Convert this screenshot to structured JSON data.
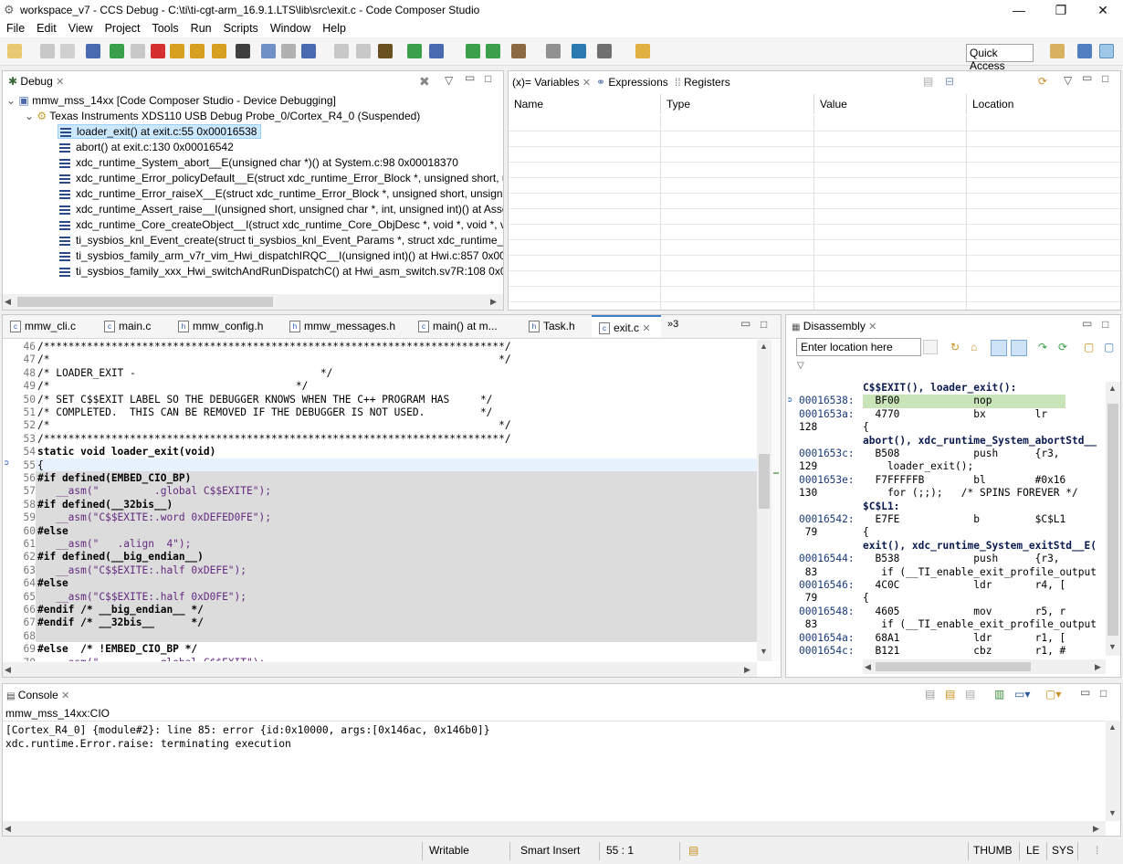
{
  "window": {
    "title": "workspace_v7 - CCS Debug - C:\\ti\\ti-cgt-arm_16.9.1.LTS\\lib\\src\\exit.c - Code Composer Studio",
    "minimize": "—",
    "maximize": "❐",
    "close": "✕"
  },
  "menu": [
    "File",
    "Edit",
    "View",
    "Project",
    "Tools",
    "Run",
    "Scripts",
    "Window",
    "Help"
  ],
  "toolbar": {
    "quick_access": "Quick Access"
  },
  "debug_view": {
    "tab": "Debug",
    "target": "mmw_mss_14xx [Code Composer Studio - Device Debugging]",
    "probe": "Texas Instruments XDS110 USB Debug Probe_0/Cortex_R4_0 (Suspended)",
    "frames": [
      "loader_exit() at exit.c:55 0x00016538",
      "abort() at exit.c:130 0x00016542",
      "xdc_runtime_System_abort__E(unsigned char *)() at System.c:98 0x00018370",
      "xdc_runtime_Error_policyDefault__E(struct xdc_runtime_Error_Block *, unsigned short, unsign",
      "xdc_runtime_Error_raiseX__E(struct xdc_runtime_Error_Block *, unsigned short, unsigned char",
      "xdc_runtime_Assert_raise__I(unsigned short, unsigned char *, int, unsigned int)() at Assert.c:3",
      "xdc_runtime_Core_createObject__I(struct xdc_runtime_Core_ObjDesc *, void *, void *, void *,",
      "ti_sysbios_knl_Event_create(struct ti_sysbios_knl_Event_Params *, struct xdc_runtime_Error_Bl",
      "ti_sysbios_family_arm_v7r_vim_Hwi_dispatchIRQC__I(unsigned int)() at Hwi.c:857 0x0000747C",
      "ti_sysbios_family_xxx_Hwi_switchAndRunDispatchC() at Hwi_asm_switch.sv7R:108 0x000134F"
    ]
  },
  "variables_view": {
    "tabs": [
      "(x)= Variables",
      "Expressions",
      "Registers"
    ],
    "columns": [
      "Name",
      "Type",
      "Value",
      "Location"
    ]
  },
  "editor": {
    "tabs": [
      "mmw_cli.c",
      "main.c",
      "mmw_config.h",
      "mmw_messages.h",
      "main() at m...",
      "Task.h",
      "exit.c"
    ],
    "overflow": "»3",
    "lines": [
      {
        "n": "46",
        "t": "/***************************************************************************/"
      },
      {
        "n": "47",
        "t": "/*                                                                         */"
      },
      {
        "n": "48",
        "t": "/* LOADER_EXIT -                              */"
      },
      {
        "n": "49",
        "t": "/*                                        */"
      },
      {
        "n": "50",
        "t": "/* SET C$$EXIT LABEL SO THE DEBUGGER KNOWS WHEN THE C++ PROGRAM HAS     */"
      },
      {
        "n": "51",
        "t": "/* COMPLETED.  THIS CAN BE REMOVED IF THE DEBUGGER IS NOT USED.         */"
      },
      {
        "n": "52",
        "t": "/*                                                                         */"
      },
      {
        "n": "53",
        "t": "/***************************************************************************/"
      },
      {
        "n": "54",
        "t": "static void loader_exit(void)"
      },
      {
        "n": "55",
        "t": "{"
      },
      {
        "n": "56",
        "t": "#if defined(EMBED_CIO_BP)"
      },
      {
        "n": "57",
        "t": "   __asm(\"         .global C$$EXITE\");"
      },
      {
        "n": "58",
        "t": "#if defined(__32bis__)"
      },
      {
        "n": "59",
        "t": "   __asm(\"C$$EXITE:.word 0xDEFED0FE\");"
      },
      {
        "n": "60",
        "t": "#else"
      },
      {
        "n": "61",
        "t": "   __asm(\"   .align  4\");"
      },
      {
        "n": "62",
        "t": "#if defined(__big_endian__)"
      },
      {
        "n": "63",
        "t": "   __asm(\"C$$EXITE:.half 0xDEFE\");"
      },
      {
        "n": "64",
        "t": "#else"
      },
      {
        "n": "65",
        "t": "   __asm(\"C$$EXITE:.half 0xD0FE\");"
      },
      {
        "n": "66",
        "t": "#endif /* __big_endian__ */"
      },
      {
        "n": "67",
        "t": "#endif /* __32bis__      */"
      },
      {
        "n": "68",
        "t": ""
      },
      {
        "n": "69",
        "t": "#else  /* !EMBED_CIO_BP */"
      },
      {
        "n": "70",
        "t": "   __asm(\"         .global C$$EXIT\");"
      }
    ]
  },
  "disassembly": {
    "tab": "Disassembly",
    "location_placeholder": "Enter location here",
    "lines": [
      {
        "a": "",
        "t": "C$$EXIT(), loader_exit():",
        "h": true
      },
      {
        "a": "00016538:",
        "t": "  BF00            nop",
        "cur": true
      },
      {
        "a": "0001653a:",
        "t": "  4770            bx        lr"
      },
      {
        "a": "128",
        "t": "{"
      },
      {
        "a": "",
        "t": "abort(), xdc_runtime_System_abortStd__",
        "h": true
      },
      {
        "a": "0001653c:",
        "t": "  B508            push      {r3,"
      },
      {
        "a": "129",
        "t": "    loader_exit();"
      },
      {
        "a": "0001653e:",
        "t": "  F7FFFFFB        bl        #0x16"
      },
      {
        "a": "130",
        "t": "    for (;;);   /* SPINS FOREVER */"
      },
      {
        "a": "",
        "t": "$C$L1:",
        "h": true
      },
      {
        "a": "00016542:",
        "t": "  E7FE            b         $C$L1"
      },
      {
        "a": " 79",
        "t": "{"
      },
      {
        "a": "",
        "t": "exit(), xdc_runtime_System_exitStd__E(",
        "h": true
      },
      {
        "a": "00016544:",
        "t": "  B538            push      {r3,"
      },
      {
        "a": " 83",
        "t": "   if (__TI_enable_exit_profile_output"
      },
      {
        "a": "00016546:",
        "t": "  4C0C            ldr       r4, ["
      },
      {
        "a": " 79",
        "t": "{"
      },
      {
        "a": "00016548:",
        "t": "  4605            mov       r5, r"
      },
      {
        "a": " 83",
        "t": "   if (__TI_enable_exit_profile_output"
      },
      {
        "a": "0001654a:",
        "t": "  68A1            ldr       r1, ["
      },
      {
        "a": "0001654c:",
        "t": "  B121            cbz       r1, #"
      }
    ]
  },
  "console": {
    "tab": "Console",
    "subtitle": "mmw_mss_14xx:CIO",
    "lines": [
      "[Cortex_R4_0] {module#2}: line 85: error {id:0x10000, args:[0x146ac, 0x146b0]}",
      "xdc.runtime.Error.raise: terminating execution"
    ]
  },
  "status": {
    "writable": "Writable",
    "insert": "Smart Insert",
    "position": "55 : 1",
    "mode": "THUMB",
    "endian": "LE",
    "sys": "SYS"
  }
}
